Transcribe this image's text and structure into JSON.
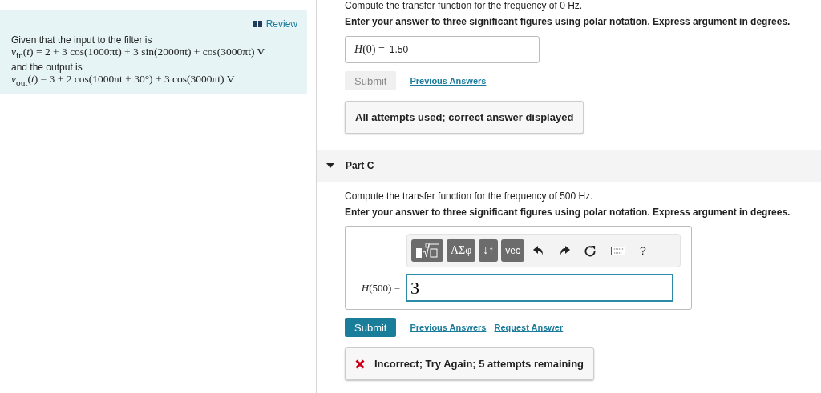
{
  "review_panel": {
    "link": "Review",
    "intro": "Given that the input to the filter is",
    "input_formula": "*v*$_{in}$(*t*) = 2 + 3 cos(1000πt) + 3 sin(2000πt) + cos(3000πt) V",
    "middle": "and the output is",
    "output_formula": "*v*$_{out}$(*t*) = 3 + 2 cos(1000πt + 30°) + 3 cos(3000πt) V"
  },
  "part_b": {
    "prompt": "Compute the transfer function for the frequency of 0 Hz.",
    "instruction": "Enter your answer to three significant figures using polar notation. Express argument in degrees.",
    "answer": {
      "label": "*H*(0) =",
      "value": "1.50"
    },
    "submit": {
      "label": "Submit",
      "disabled": true
    },
    "links": [
      "Previous Answers"
    ],
    "feedback": {
      "text": "All attempts used; correct answer displayed"
    }
  },
  "part_c": {
    "title": "Part C",
    "expanded": true,
    "prompt": "Compute the transfer function for the frequency of 500 Hz.",
    "instruction": "Enter your answer to three significant figures using polar notation. Express argument in degrees.",
    "toolbar": [
      {
        "kind": "templates"
      },
      {
        "kind": "text",
        "label": "ΑΣφ"
      },
      {
        "kind": "text",
        "label": "↓↑"
      },
      {
        "kind": "text",
        "label": "vec"
      },
      {
        "kind": "undo"
      },
      {
        "kind": "redo"
      },
      {
        "kind": "reset"
      },
      {
        "kind": "keyboard"
      },
      {
        "kind": "plain",
        "label": "?"
      }
    ],
    "answer": {
      "label": "*H*(500) =",
      "value": "3"
    },
    "submit": {
      "label": "Submit",
      "disabled": false
    },
    "links": [
      "Previous Answers",
      "Request Answer"
    ],
    "feedback": {
      "kind": "error",
      "text": "Incorrect; Try Again; 5 attempts remaining"
    }
  }
}
